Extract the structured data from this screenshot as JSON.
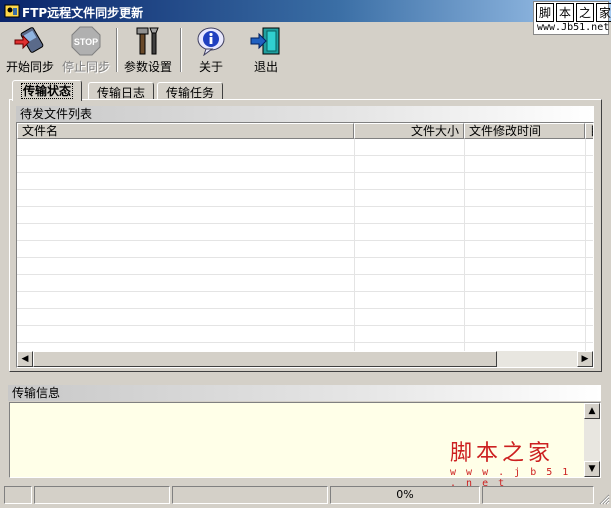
{
  "window": {
    "title": "FTP远程文件同步更新"
  },
  "watermark": {
    "chars": [
      "脚",
      "本",
      "之",
      "家"
    ],
    "url": "www.Jb51.net",
    "bottom_text": "脚本之家",
    "bottom_url": "w w w . j b 5 1 . n e t"
  },
  "toolbar": {
    "start_sync": "开始同步",
    "stop_sync": "停止同步",
    "settings": "参数设置",
    "about": "关于",
    "exit": "退出",
    "stop_icon_text": "STOP"
  },
  "tabs": [
    "传输状态",
    "传输日志",
    "传输任务"
  ],
  "pending_list": {
    "title": "待发文件列表",
    "columns": [
      "文件名",
      "文件大小",
      "文件修改时间",
      "目"
    ]
  },
  "info": {
    "title": "传输信息"
  },
  "status": {
    "progress": "0%"
  },
  "colors": {
    "title_gradient_start": "#0a246a",
    "info_bg": "#ffffe8",
    "face": "#d4d0c8"
  }
}
